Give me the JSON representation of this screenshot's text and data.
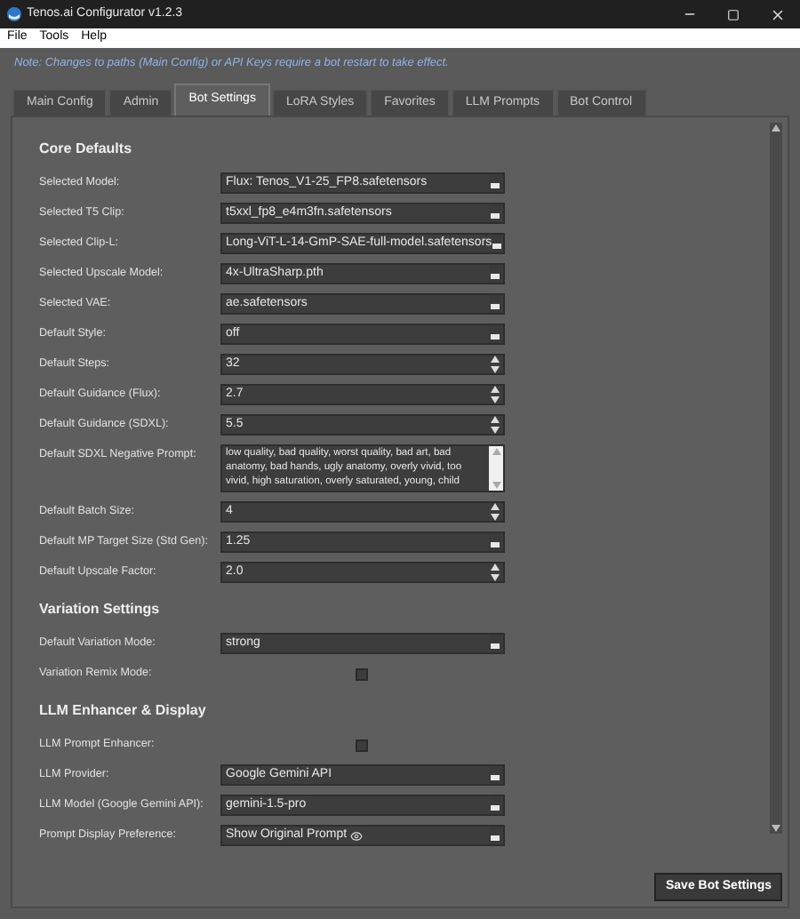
{
  "window": {
    "title": "Tenos.ai Configurator v1.2.3"
  },
  "menu": [
    "File",
    "Tools",
    "Help"
  ],
  "note": "Note: Changes to paths (Main Config) or API Keys require a bot restart to take effect.",
  "tabs": [
    {
      "label": "Main Config",
      "selected": false
    },
    {
      "label": "Admin",
      "selected": false
    },
    {
      "label": "Bot Settings",
      "selected": true
    },
    {
      "label": "LoRA Styles",
      "selected": false
    },
    {
      "label": "Favorites",
      "selected": false
    },
    {
      "label": "LLM Prompts",
      "selected": false
    },
    {
      "label": "Bot Control",
      "selected": false
    }
  ],
  "sections": [
    {
      "title": "Core Defaults",
      "rows": [
        {
          "label": "Selected Model:",
          "kind": "select",
          "value": "Flux: Tenos_V1-25_FP8.safetensors"
        },
        {
          "label": "Selected T5 Clip:",
          "kind": "select",
          "value": "t5xxl_fp8_e4m3fn.safetensors"
        },
        {
          "label": "Selected Clip-L:",
          "kind": "select",
          "value": "Long-ViT-L-14-GmP-SAE-full-model.safetensors"
        },
        {
          "label": "Selected Upscale Model:",
          "kind": "select",
          "value": "4x-UltraSharp.pth"
        },
        {
          "label": "Selected VAE:",
          "kind": "select",
          "value": "ae.safetensors"
        },
        {
          "label": "Default Style:",
          "kind": "select",
          "value": "off"
        },
        {
          "label": "Default Steps:",
          "kind": "spin",
          "value": "32"
        },
        {
          "label": "Default Guidance (Flux):",
          "kind": "spin",
          "value": "2.7"
        },
        {
          "label": "Default Guidance (SDXL):",
          "kind": "spin",
          "value": "5.5"
        },
        {
          "label": "Default SDXL Negative Prompt:",
          "kind": "textarea",
          "value": "low quality, bad quality, worst quality, bad art, bad anatomy, bad hands, ugly anatomy, overly vivid, too vivid, high saturation, overly saturated, young, child"
        },
        {
          "label": "Default Batch Size:",
          "kind": "spin",
          "value": "4"
        },
        {
          "label": "Default MP Target Size (Std Gen):",
          "kind": "select",
          "value": "1.25"
        },
        {
          "label": "Default Upscale Factor:",
          "kind": "spin",
          "value": "2.0"
        }
      ]
    },
    {
      "title": "Variation Settings",
      "rows": [
        {
          "label": "Default Variation Mode:",
          "kind": "select",
          "value": "strong"
        },
        {
          "label": "Variation Remix Mode:",
          "kind": "checkbox",
          "checked": false
        }
      ]
    },
    {
      "title": "LLM Enhancer & Display",
      "rows": [
        {
          "label": "LLM Prompt Enhancer:",
          "kind": "checkbox",
          "checked": false
        },
        {
          "label": "LLM Provider:",
          "kind": "select",
          "value": "Google Gemini API"
        },
        {
          "label": "LLM Model (Google Gemini API):",
          "kind": "select",
          "value": "gemini-1.5-pro"
        },
        {
          "label": "Prompt Display Preference:",
          "kind": "select",
          "value": "Show Original Prompt",
          "eye": true
        }
      ]
    }
  ],
  "save_button": "Save Bot Settings"
}
